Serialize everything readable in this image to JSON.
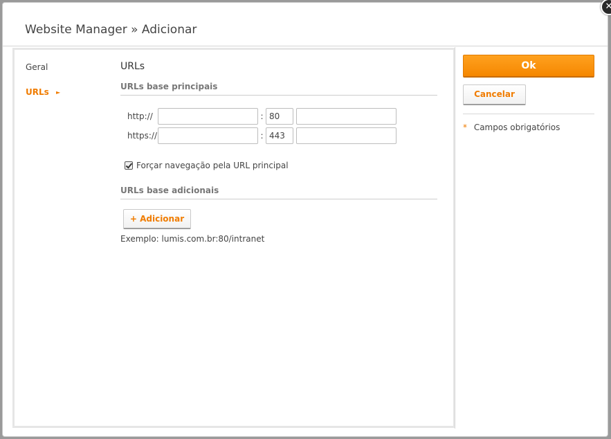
{
  "window": {
    "title": "Website Manager » Adicionar",
    "close_icon": "close-icon"
  },
  "nav": {
    "items": [
      {
        "label": "Geral",
        "active": false
      },
      {
        "label": "URLs",
        "active": true
      }
    ],
    "active_indicator": "►"
  },
  "main": {
    "section_title": "URLs",
    "primary_urls": {
      "title": "URLs base principais",
      "rows": [
        {
          "protocol": "http://",
          "host": "",
          "port": "80",
          "path": ""
        },
        {
          "protocol": "https://",
          "host": "",
          "port": "443",
          "path": ""
        }
      ],
      "separator": ":"
    },
    "force_navigation": {
      "label": "Forçar navegação pela URL principal",
      "checked": true
    },
    "additional_urls": {
      "title": "URLs base adicionais",
      "add_button": "+ Adicionar",
      "example": "Exemplo: lumis.com.br:80/intranet"
    }
  },
  "actions": {
    "ok_label": "Ok",
    "cancel_label": "Cancelar"
  },
  "footer_note": {
    "star": "*",
    "text": "Campos obrigatórios"
  },
  "colors": {
    "accent": "#f07c00",
    "ok_button": "#f58700",
    "text": "#444444"
  }
}
